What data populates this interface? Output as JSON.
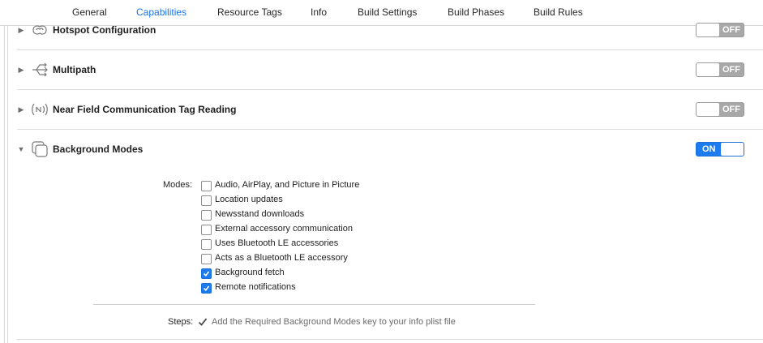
{
  "tabs": [
    {
      "label": "General",
      "active": false
    },
    {
      "label": "Capabilities",
      "active": true
    },
    {
      "label": "Resource Tags",
      "active": false
    },
    {
      "label": "Info",
      "active": false
    },
    {
      "label": "Build Settings",
      "active": false
    },
    {
      "label": "Build Phases",
      "active": false
    },
    {
      "label": "Build Rules",
      "active": false
    }
  ],
  "capabilities": [
    {
      "title": "Hotspot Configuration",
      "icon": "hotspot-icon",
      "expanded": false,
      "state": "OFF"
    },
    {
      "title": "Multipath",
      "icon": "multipath-icon",
      "expanded": false,
      "state": "OFF"
    },
    {
      "title": "Near Field Communication Tag Reading",
      "icon": "nfc-icon",
      "expanded": false,
      "state": "OFF"
    },
    {
      "title": "Background Modes",
      "icon": "background-modes-icon",
      "expanded": true,
      "state": "ON"
    }
  ],
  "background_modes": {
    "modes_label": "Modes:",
    "items": [
      {
        "label": "Audio, AirPlay, and Picture in Picture",
        "checked": false
      },
      {
        "label": "Location updates",
        "checked": false
      },
      {
        "label": "Newsstand downloads",
        "checked": false
      },
      {
        "label": "External accessory communication",
        "checked": false
      },
      {
        "label": "Uses Bluetooth LE accessories",
        "checked": false
      },
      {
        "label": "Acts as a Bluetooth LE accessory",
        "checked": false
      },
      {
        "label": "Background fetch",
        "checked": true
      },
      {
        "label": "Remote notifications",
        "checked": true
      }
    ],
    "steps_label": "Steps:",
    "steps_icon": "checkmark-icon",
    "steps_text": "Add the Required Background Modes key to your info plist file"
  },
  "colors": {
    "accent": "#1d7bf0",
    "toggle_off": "#a8a8a8"
  }
}
